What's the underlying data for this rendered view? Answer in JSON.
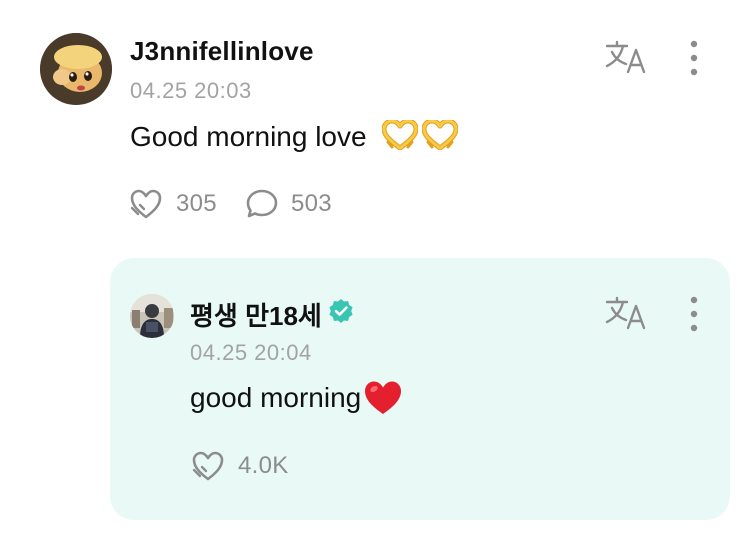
{
  "post": {
    "author": "J3nnifellinlove",
    "timestamp": "04.25 20:03",
    "text": "Good morning love",
    "emojis": [
      "heart-hands-emoji",
      "heart-hands-emoji"
    ],
    "avatar_icon": "avatar-cartoon-face",
    "translate_icon": "translate-icon",
    "more_icon": "more-vertical-icon",
    "like_icon": "heart-outline-icon",
    "like_count": "305",
    "comment_icon": "comment-bubble-icon",
    "comment_count": "503"
  },
  "reply": {
    "author": "평생 만18세",
    "verified": true,
    "verified_icon": "verified-badge-icon",
    "timestamp": "04.25 20:04",
    "text": "good morning",
    "emoji": "red-heart-emoji",
    "avatar_icon": "avatar-photo",
    "translate_icon": "translate-icon",
    "more_icon": "more-vertical-icon",
    "like_icon": "heart-outline-icon",
    "like_count": "4.0K"
  },
  "colors": {
    "reply_background": "#e9faf6",
    "muted_text": "#a3a3a3",
    "icon_gray": "#8c8c8c",
    "verified": "#39c5b4",
    "heart_red": "#e5202e"
  }
}
